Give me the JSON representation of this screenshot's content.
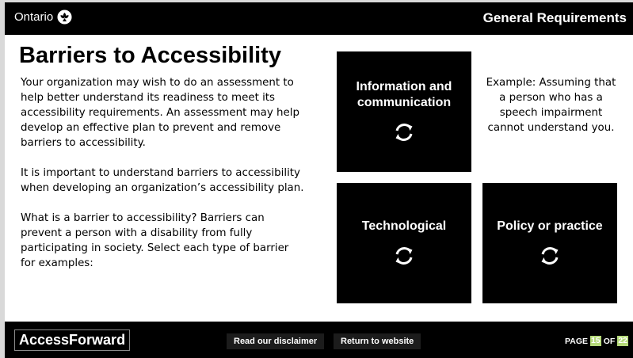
{
  "header": {
    "logo_text": "Ontario",
    "section_title": "General Requirements"
  },
  "main": {
    "title": "Barriers to Accessibility",
    "paragraphs": [
      "Your organization may wish to do an assessment to help better understand its readiness to meet its accessibility requirements. An assessment may help develop an effective plan to prevent and remove barriers to accessibility.",
      "It is important to understand barriers to accessibility when developing an organization’s accessibility plan.",
      "What is a barrier to accessibility? Barriers can prevent a person with a disability from fully participating in society. Select each type of barrier for examples:"
    ],
    "tiles": [
      {
        "label": "Information and communication",
        "icon": "refresh-icon"
      },
      {
        "label": "Technological",
        "icon": "refresh-icon"
      },
      {
        "label": "Policy or practice",
        "icon": "refresh-icon"
      }
    ],
    "example_text": "Example: Assuming that a person who has a speech impairment cannot understand you."
  },
  "footer": {
    "brand": "AccessForward",
    "disclaimer_label": "Read our disclaimer",
    "return_label": "Return to website",
    "page_label": "PAGE",
    "page_current": "15",
    "page_of": "OF",
    "page_total": "22"
  },
  "colors": {
    "background": "#ffffff",
    "bar": "#000000",
    "tile": "#000000",
    "page_number_highlight": "#b5d97a"
  }
}
